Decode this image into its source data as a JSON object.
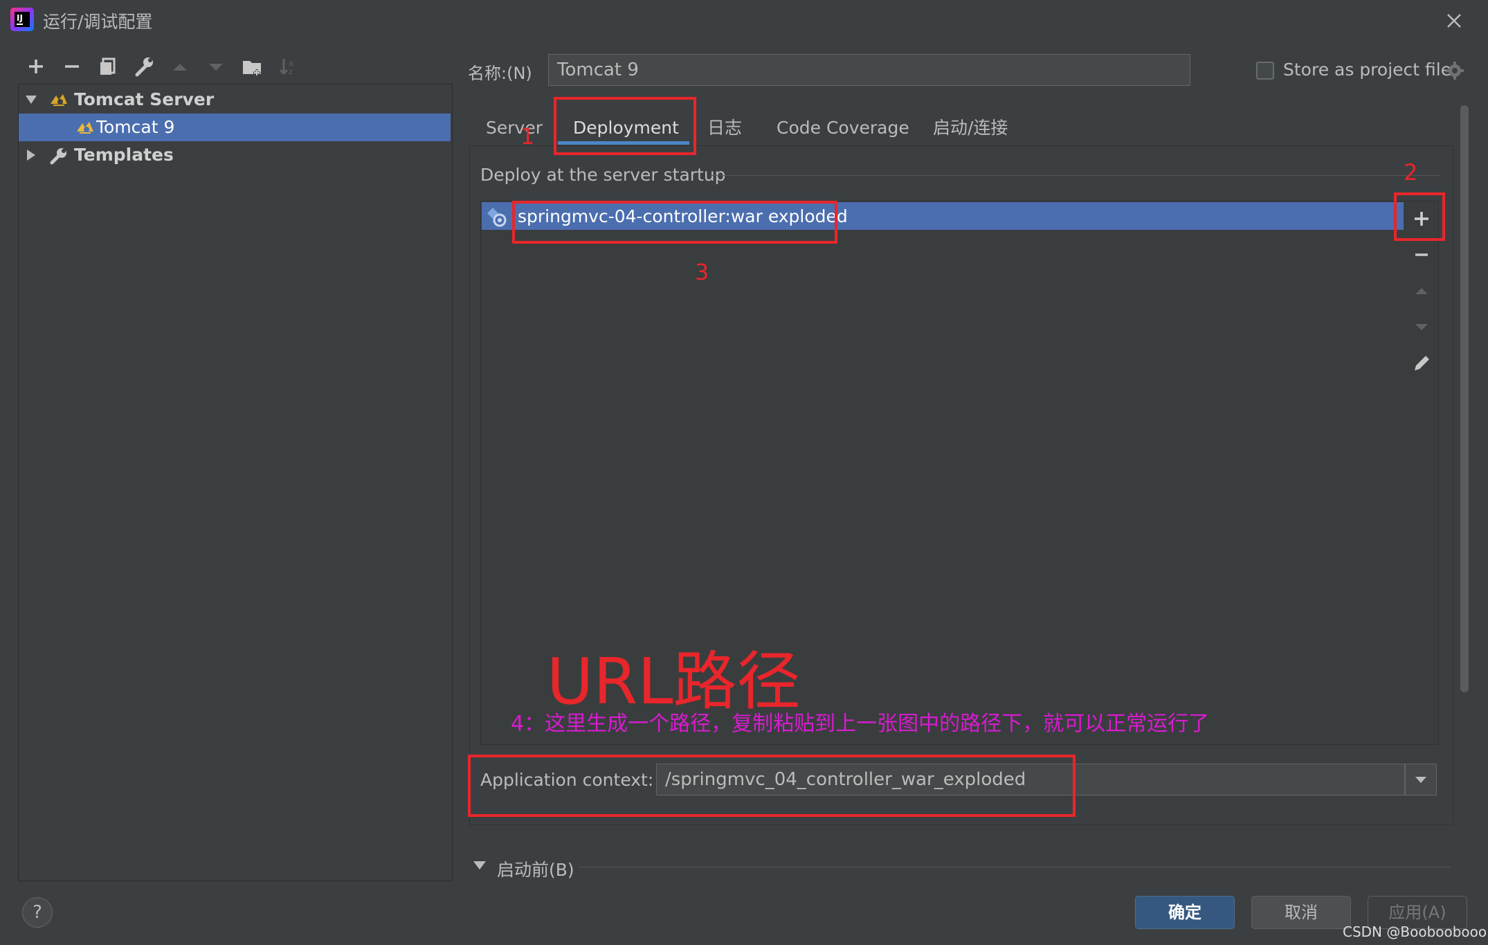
{
  "window": {
    "title": "运行/调试配置",
    "close_icon": "close-icon"
  },
  "toolbar": {
    "icons": [
      "add-icon",
      "remove-icon",
      "copy-icon",
      "wrench-icon",
      "move-up-icon",
      "move-down-icon",
      "folder-icon",
      "sort-icon"
    ]
  },
  "tree": {
    "group": "Tomcat Server",
    "child": "Tomcat 9",
    "templates": "Templates"
  },
  "name": {
    "label": "名称:(N)",
    "value": "Tomcat 9",
    "store_label": "Store as project file"
  },
  "tabs": [
    "Server",
    "Deployment",
    "日志",
    "Code Coverage",
    "启动/连接"
  ],
  "deployment": {
    "section_title": "Deploy at the server startup",
    "artifact": "springmvc-04-controller:war exploded",
    "app_context_label": "Application context:",
    "app_context_value": "/springmvc_04_controller_war_exploded"
  },
  "before_launch": "启动前(B)",
  "buttons": {
    "ok": "确定",
    "cancel": "取消",
    "apply": "应用(A)",
    "help": "?"
  },
  "annotations": {
    "num1": "1",
    "num2": "2",
    "num3": "3",
    "url": "URL路径",
    "step4": "4：这里生成一个路径，复制粘贴到上一张图中的路径下，就可以正常运行了"
  },
  "watermark": "CSDN @Booboobooo",
  "colors": {
    "selection": "#4b6eaf",
    "annotation_red": "#e8262b",
    "annotation_magenta": "#d81bd0",
    "primary_button": "#365880"
  }
}
